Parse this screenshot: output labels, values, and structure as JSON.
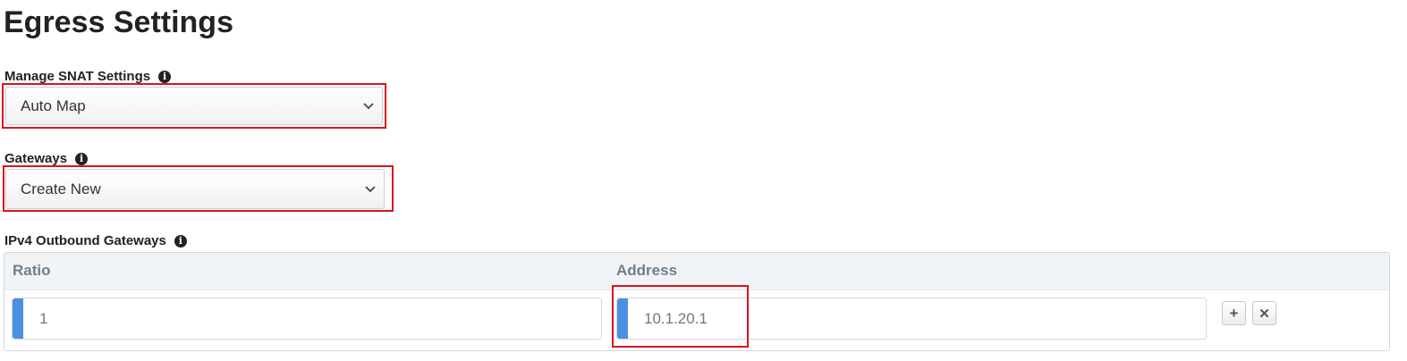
{
  "page": {
    "title": "Egress Settings"
  },
  "snat": {
    "label": "Manage SNAT Settings",
    "info_icon": "info-circle-icon",
    "selected": "Auto Map"
  },
  "gateways": {
    "label": "Gateways",
    "info_icon": "info-circle-icon",
    "selected": "Create New"
  },
  "ipv4_outbound": {
    "label": "IPv4 Outbound Gateways",
    "info_icon": "info-circle-icon",
    "columns": [
      "Ratio",
      "Address"
    ],
    "rows": [
      {
        "ratio": "1",
        "address": "10.1.20.1"
      }
    ],
    "add_icon": "plus-icon",
    "remove_icon": "close-icon"
  },
  "colors": {
    "highlight": "#d9141c",
    "accent": "#4a90e2",
    "header_text": "#6f7f8e"
  }
}
